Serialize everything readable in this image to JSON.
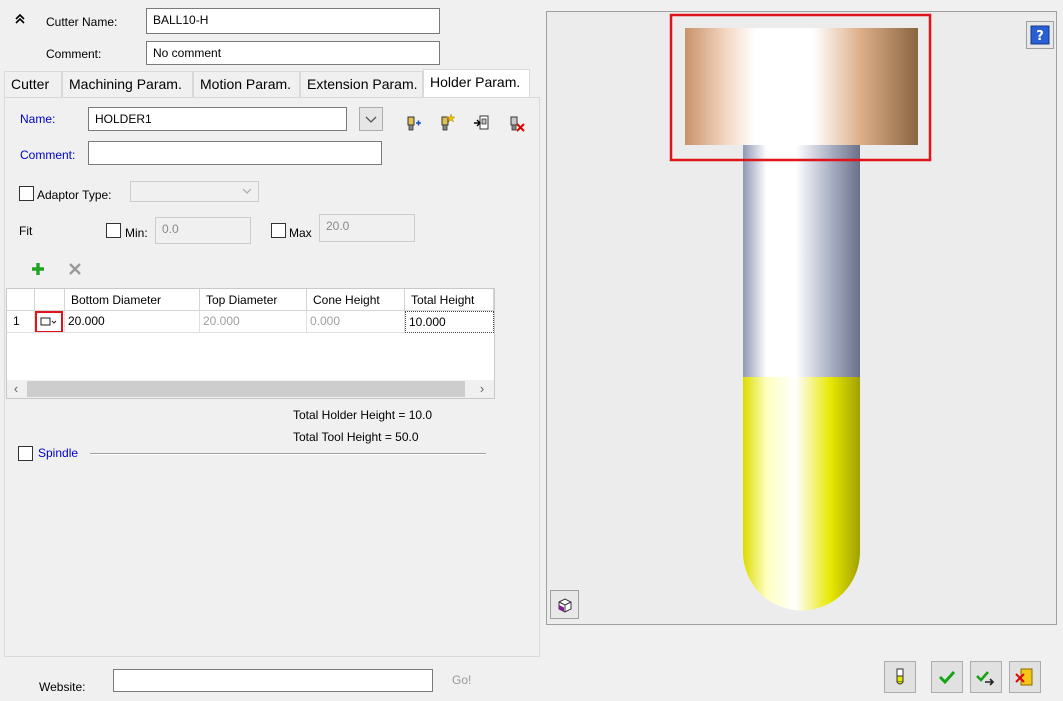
{
  "header": {
    "cutter_name_label": "Cutter Name:",
    "cutter_name_value": "BALL10-H",
    "comment_label": "Comment:",
    "comment_value": "No comment"
  },
  "tabs": [
    {
      "label": "Cutter"
    },
    {
      "label": "Machining Param."
    },
    {
      "label": "Motion Param."
    },
    {
      "label": "Extension Param."
    },
    {
      "label": "Holder Param."
    }
  ],
  "holder": {
    "name_label": "Name:",
    "name_value": "HOLDER1",
    "comment_label": "Comment:",
    "comment_value": "",
    "adaptor_label": "Adaptor Type:",
    "adaptor_value": "",
    "fit_label": "Fit",
    "min_label": "Min:",
    "min_value": "0.0",
    "max_label": "Max",
    "max_value": "20.0"
  },
  "grid": {
    "columns": [
      "Bottom Diameter",
      "Top Diameter",
      "Cone Height",
      "Total Height"
    ],
    "rows": [
      {
        "index": "1",
        "bottom": "20.000",
        "top": "20.000",
        "cone": "0.000",
        "total": "10.000"
      }
    ]
  },
  "summary": {
    "holder_height": "Total Holder Height = 10.0",
    "tool_height": "Total Tool Height = 50.0"
  },
  "spindle_label": "Spindle",
  "footer": {
    "website_label": "Website:",
    "website_value": "",
    "go_label": "Go!"
  },
  "icons": {
    "collapse": "double-chevron-up-icon",
    "help": "help-icon",
    "view": "3d-view-icon"
  },
  "colors": {
    "label_blue": "#0000c8",
    "highlight_red": "#e0151b",
    "holder_copper": "#c8926a",
    "shank_steel": "#8c93a8",
    "cutter_yellow": "#e6e600"
  }
}
